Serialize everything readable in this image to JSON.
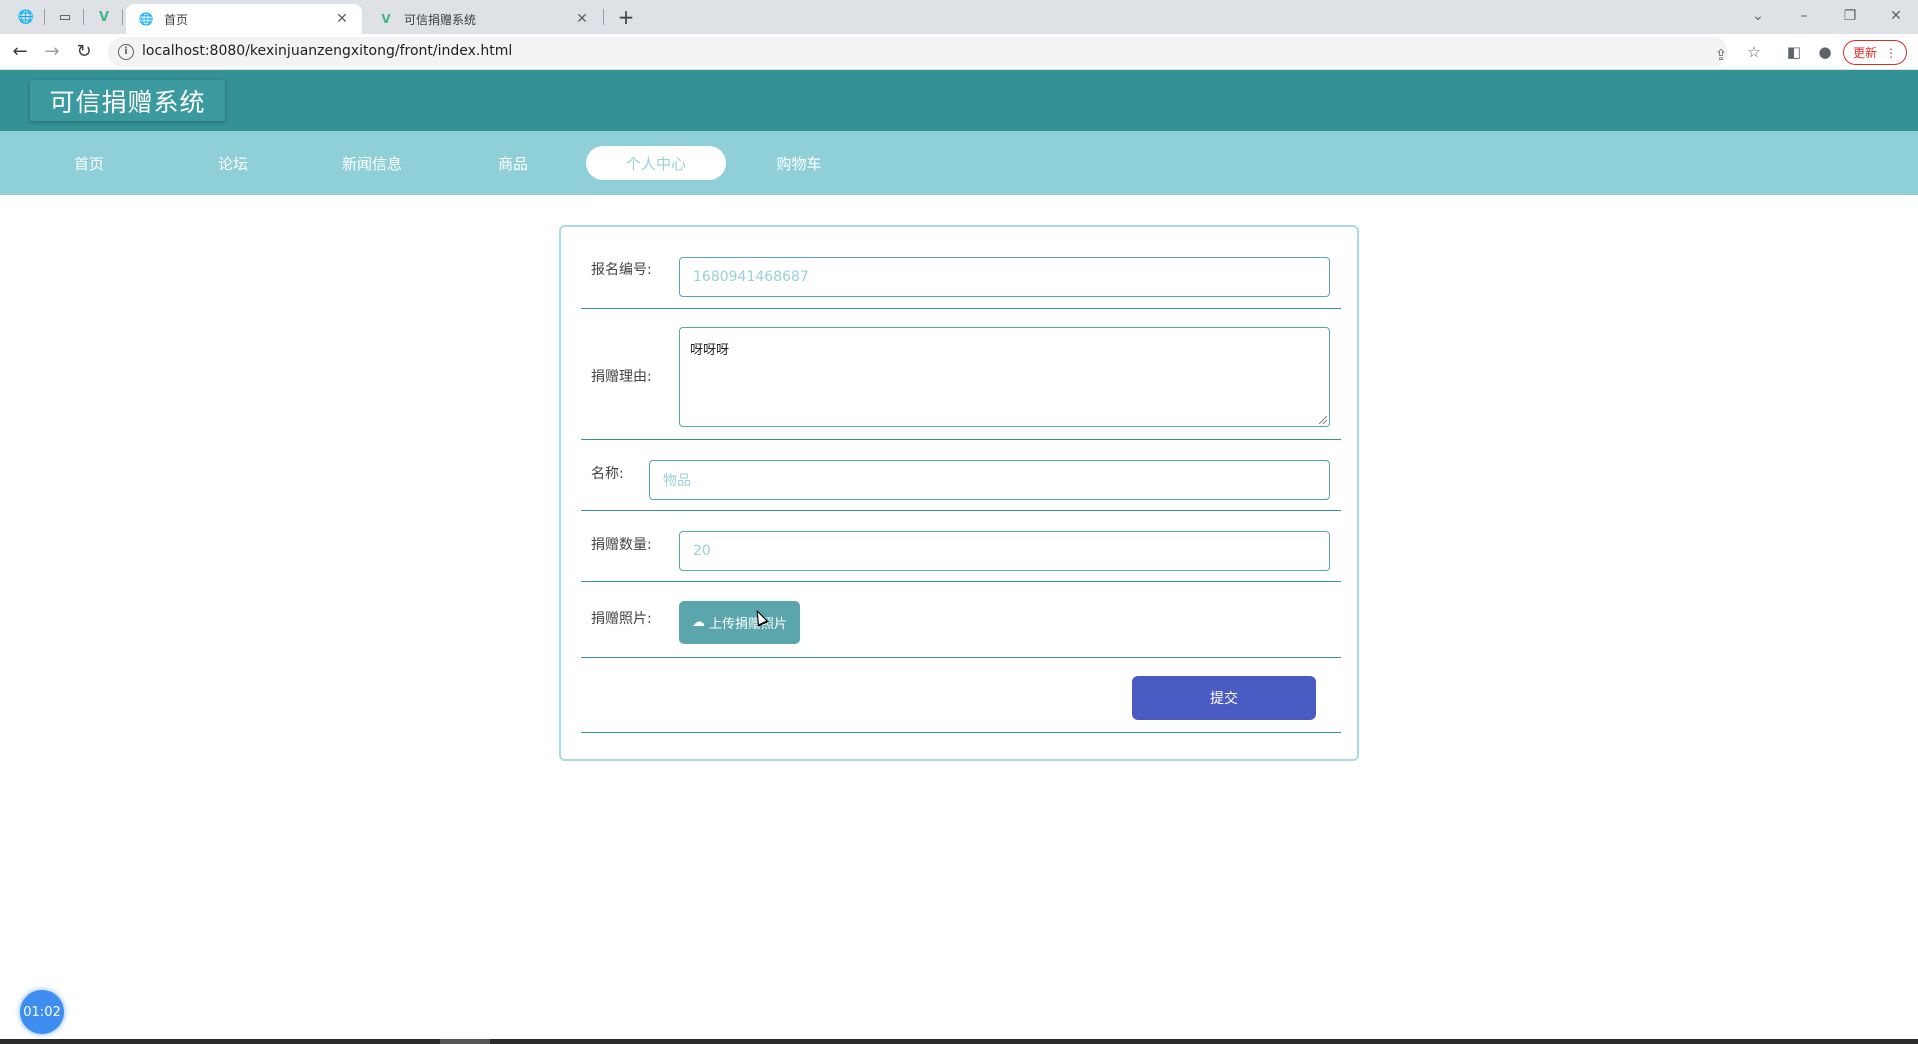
{
  "browser": {
    "tabs": [
      {
        "title": "首页",
        "active": true
      },
      {
        "title": "可信捐赠系统",
        "active": false
      }
    ],
    "url": "localhost:8080/kexinjuanzengxitong/front/index.html",
    "update_label": "更新"
  },
  "site": {
    "title": "可信捐赠系统",
    "nav": [
      {
        "label": "首页"
      },
      {
        "label": "论坛"
      },
      {
        "label": "新闻信息"
      },
      {
        "label": "商品"
      },
      {
        "label": "个人中心",
        "active": true
      },
      {
        "label": "购物车"
      }
    ]
  },
  "form": {
    "fields": {
      "signup_id": {
        "label": "报名编号:",
        "value": "1680941468687"
      },
      "reason": {
        "label": "捐赠理由:",
        "value": "呀呀呀"
      },
      "name": {
        "label": "名称:",
        "value": "物品"
      },
      "quantity": {
        "label": "捐赠数量:",
        "value": "20"
      },
      "photo": {
        "label": "捐赠照片:",
        "button_label": "上传捐赠照片"
      }
    },
    "submit_label": "提交"
  },
  "timer": "01:02",
  "colors": {
    "header": "#349297",
    "nav": "#8ecfd8",
    "accent": "#5ba6ad",
    "submit": "#4b5bc4"
  }
}
